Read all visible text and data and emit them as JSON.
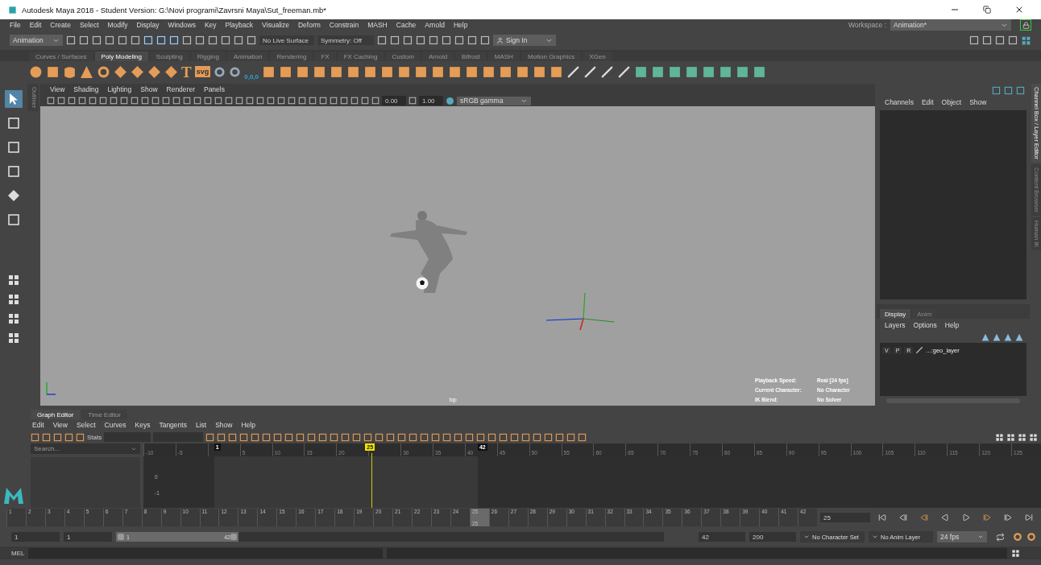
{
  "window": {
    "title": "Autodesk Maya 2018 - Student Version: G:\\Novi programi\\Zavrsni Maya\\Sut_freeman.mb*"
  },
  "menu_bar": [
    "File",
    "Edit",
    "Create",
    "Select",
    "Modify",
    "Display",
    "Windows",
    "Key",
    "Playback",
    "Visualize",
    "Deform",
    "Constrain",
    "MASH",
    "Cache",
    "Arnold",
    "Help"
  ],
  "workspace": {
    "label": "Workspace :",
    "value": "Animation*"
  },
  "status_line": {
    "menu_set": "Animation",
    "live_surface": "No Live Surface",
    "symmetry": "Symmetry: Off",
    "sign_in": "Sign In"
  },
  "shelf_tabs": [
    {
      "label": "Curves / Surfaces",
      "selected": false
    },
    {
      "label": "Poly Modeling",
      "selected": true
    },
    {
      "label": "Sculpting",
      "selected": false
    },
    {
      "label": "Rigging",
      "selected": false
    },
    {
      "label": "Animation",
      "selected": false
    },
    {
      "label": "Rendering",
      "selected": false
    },
    {
      "label": "FX",
      "selected": false
    },
    {
      "label": "FX Caching",
      "selected": false
    },
    {
      "label": "Custom",
      "selected": false
    },
    {
      "label": "Arnold",
      "selected": false
    },
    {
      "label": "Bifrost",
      "selected": false
    },
    {
      "label": "MASH",
      "selected": false
    },
    {
      "label": "Motion Graphics",
      "selected": false
    },
    {
      "label": "XGen",
      "selected": false
    }
  ],
  "shelf": {
    "text_tool": "T",
    "svg_tool": "svg",
    "origin_tool": "0,0,0"
  },
  "outliner_tab": "Outliner",
  "viewport": {
    "menu": [
      "View",
      "Shading",
      "Lighting",
      "Show",
      "Renderer",
      "Panels"
    ],
    "exposure": "0.00",
    "gamma": "1.00",
    "color_space": "sRGB gamma",
    "camera_label": "top",
    "hud": [
      {
        "label": "Playback Speed:",
        "value": "Real [24 fps]"
      },
      {
        "label": "Current Character:",
        "value": "No Character"
      },
      {
        "label": "IK Blend:",
        "value": "No Solver"
      }
    ]
  },
  "channel_box": {
    "menu": [
      "Channels",
      "Edit",
      "Object",
      "Show"
    ],
    "layer_tabs": [
      {
        "label": "Display",
        "selected": true
      },
      {
        "label": "Anim",
        "selected": false
      }
    ],
    "layer_menu": [
      "Layers",
      "Options",
      "Help"
    ],
    "layers": [
      {
        "visible": "V",
        "playback": "P",
        "render": "R",
        "name": "...:geo_layer"
      }
    ]
  },
  "side_tabs": [
    {
      "label": "Channel Box / Layer Editor",
      "selected": true
    },
    {
      "label": "Content Browser",
      "selected": false
    },
    {
      "label": "Human IK",
      "selected": false
    }
  ],
  "graph_editor": {
    "tabs": [
      {
        "label": "Graph Editor",
        "selected": true
      },
      {
        "label": "Time Editor",
        "selected": false
      }
    ],
    "menu": [
      "Edit",
      "View",
      "Select",
      "Curves",
      "Keys",
      "Tangents",
      "List",
      "Show",
      "Help"
    ],
    "stats_label": "Stats",
    "search_placeholder": "Search...",
    "ruler": [
      "-10",
      "-5",
      "5",
      "10",
      "15",
      "20",
      "30",
      "35",
      "40",
      "45",
      "50",
      "55",
      "60",
      "65",
      "70",
      "75",
      "80",
      "85",
      "90",
      "95",
      "100",
      "105",
      "110",
      "115",
      "120",
      "125"
    ],
    "start_marker": "1",
    "current_marker": "25",
    "end_marker": "42",
    "value_labels": [
      "0",
      "-1"
    ]
  },
  "time_slider": {
    "frames": [
      {
        "label": "1",
        "selected": false
      },
      {
        "label": "2",
        "selected": false
      },
      {
        "label": "3",
        "selected": false
      },
      {
        "label": "4",
        "selected": false
      },
      {
        "label": "5",
        "selected": false
      },
      {
        "label": "6",
        "selected": false
      },
      {
        "label": "7",
        "selected": false
      },
      {
        "label": "8",
        "selected": false
      },
      {
        "label": "9",
        "selected": false
      },
      {
        "label": "10",
        "selected": false
      },
      {
        "label": "11",
        "selected": false
      },
      {
        "label": "12",
        "selected": false
      },
      {
        "label": "13",
        "selected": false
      },
      {
        "label": "14",
        "selected": false
      },
      {
        "label": "15",
        "selected": false
      },
      {
        "label": "16",
        "selected": false
      },
      {
        "label": "17",
        "selected": false
      },
      {
        "label": "18",
        "selected": false
      },
      {
        "label": "19",
        "selected": false
      },
      {
        "label": "20",
        "selected": false
      },
      {
        "label": "21",
        "selected": false
      },
      {
        "label": "22",
        "selected": false
      },
      {
        "label": "23",
        "selected": false
      },
      {
        "label": "24",
        "selected": false
      },
      {
        "label": "25",
        "selected": true
      },
      {
        "label": "26",
        "selected": false
      },
      {
        "label": "27",
        "selected": false
      },
      {
        "label": "28",
        "selected": false
      },
      {
        "label": "29",
        "selected": false
      },
      {
        "label": "30",
        "selected": false
      },
      {
        "label": "31",
        "selected": false
      },
      {
        "label": "32",
        "selected": false
      },
      {
        "label": "33",
        "selected": false
      },
      {
        "label": "34",
        "selected": false
      },
      {
        "label": "35",
        "selected": false
      },
      {
        "label": "36",
        "selected": false
      },
      {
        "label": "37",
        "selected": false
      },
      {
        "label": "38",
        "selected": false
      },
      {
        "label": "39",
        "selected": false
      },
      {
        "label": "40",
        "selected": false
      },
      {
        "label": "41",
        "selected": false
      },
      {
        "label": "42",
        "selected": false
      }
    ],
    "current_label": "25",
    "current_field": "25"
  },
  "range_slider": {
    "start": "1",
    "range_start": "1",
    "bar_start": "1",
    "bar_end": "42",
    "range_end": "42",
    "end": "200",
    "character_set": "No Character Set",
    "anim_layer": "No Anim Layer",
    "fps": "24 fps"
  },
  "command_line": {
    "language": "MEL"
  }
}
